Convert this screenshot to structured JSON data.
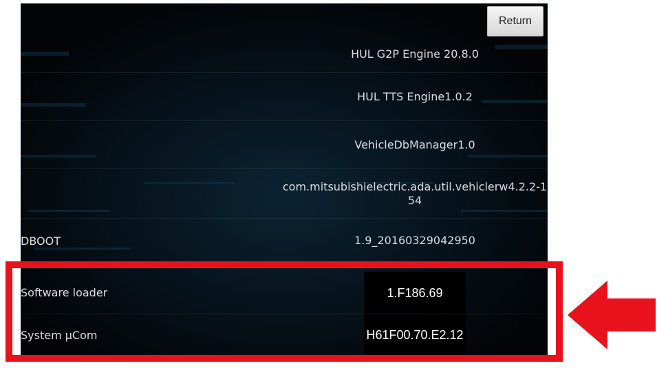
{
  "header": {
    "return_label": "Return"
  },
  "rows": [
    {
      "label": "",
      "value": "HUL G2P Engine 20.8.0"
    },
    {
      "label": "",
      "value": "HUL TTS Engine1.0.2"
    },
    {
      "label": "",
      "value": "VehicleDbManager1.0"
    },
    {
      "label": "",
      "value": "com.mitsubishielectric.ada.util.vehiclerw4.2.2-154"
    },
    {
      "label": "DBOOT",
      "value": "1.9_20160329042950"
    },
    {
      "label": "Software loader",
      "value": "1.F186.69"
    },
    {
      "label": "System µCom",
      "value": "H61F00.70.E2.12"
    }
  ],
  "annotation": {
    "highlight_color": "#e8121c",
    "arrow_color": "#e8121c",
    "arrow_icon": "arrow-left-icon"
  },
  "colors": {
    "background": "#030508",
    "text": "#d9dde2"
  }
}
